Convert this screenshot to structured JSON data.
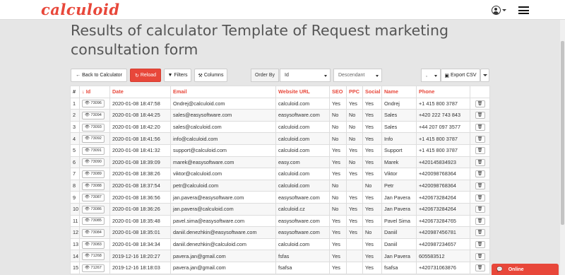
{
  "app": {
    "logo": "calculoid"
  },
  "page": {
    "title": "Results of calculator Template of Request marketing consultation form"
  },
  "toolbar": {
    "back_label": "Back to Calculator",
    "reload_label": "Reload",
    "filters_label": "Filters",
    "columns_label": "Columns",
    "orderby_label": "Order By",
    "orderby_value": "Id",
    "direction_value": "Descendant",
    "separator_value": ",",
    "export_label": "Export CSV"
  },
  "table": {
    "columns": [
      "#",
      "Id",
      "Date",
      "Email",
      "Website URL",
      "SEO",
      "PPC",
      "Social",
      "Name",
      "Phone"
    ],
    "rows": [
      {
        "n": "1",
        "id": "73096",
        "date": "2020-01-08 18:47:58",
        "email": "Ondrej@calculoid.com",
        "url": "calculoid.com",
        "seo": "Yes",
        "ppc": "Yes",
        "social": "Yes",
        "name": "Ondrej",
        "phone": "+1 415 800 3787"
      },
      {
        "n": "2",
        "id": "73094",
        "date": "2020-01-08 18:44:25",
        "email": "sales@easysoftware.com",
        "url": "easysoftware.com",
        "seo": "No",
        "ppc": "No",
        "social": "Yes",
        "name": "Sales",
        "phone": "+420 222 743 843"
      },
      {
        "n": "3",
        "id": "73093",
        "date": "2020-01-08 18:42:20",
        "email": "sales@calculoid.com",
        "url": "calculoid.com",
        "seo": "No",
        "ppc": "No",
        "social": "Yes",
        "name": "Sales",
        "phone": "+44 207 097 3577"
      },
      {
        "n": "4",
        "id": "73092",
        "date": "2020-01-08 18:41:56",
        "email": "info@calculoid.com",
        "url": "calculoid.com",
        "seo": "No",
        "ppc": "No",
        "social": "Yes",
        "name": "Info",
        "phone": "+1 415 800 3787"
      },
      {
        "n": "5",
        "id": "73091",
        "date": "2020-01-08 18:41:32",
        "email": "support@calculoid.com",
        "url": "calculoid.com",
        "seo": "Yes",
        "ppc": "Yes",
        "social": "Yes",
        "name": "Support",
        "phone": "+1 415 800 3787"
      },
      {
        "n": "6",
        "id": "73090",
        "date": "2020-01-08 18:39:09",
        "email": "marek@easysoftware.com",
        "url": "easy.com",
        "seo": "Yes",
        "ppc": "No",
        "social": "Yes",
        "name": "Marek",
        "phone": "+420145834923"
      },
      {
        "n": "7",
        "id": "73089",
        "date": "2020-01-08 18:38:26",
        "email": "viktor@calculoid.com",
        "url": "calculoid.com",
        "seo": "Yes",
        "ppc": "Yes",
        "social": "Yes",
        "name": "Viktor",
        "phone": "+420098768364"
      },
      {
        "n": "8",
        "id": "73088",
        "date": "2020-01-08 18:37:54",
        "email": "petr@calculoid.com",
        "url": "calculoid.com",
        "seo": "No",
        "ppc": "",
        "social": "No",
        "name": "Petr",
        "phone": "+420098768364"
      },
      {
        "n": "9",
        "id": "73087",
        "date": "2020-01-08 18:36:56",
        "email": "jan.pavera@easysoftware.com",
        "url": "easysoftware.com",
        "seo": "No",
        "ppc": "Yes",
        "social": "Yes",
        "name": "Jan Pavera",
        "phone": "+420673284264"
      },
      {
        "n": "10",
        "id": "73086",
        "date": "2020-01-08 18:36:26",
        "email": "jan.pavera@calculoid.com",
        "url": "calculoid.cz",
        "seo": "No",
        "ppc": "Yes",
        "social": "Yes",
        "name": "Jan Pavera",
        "phone": "+420673284264"
      },
      {
        "n": "11",
        "id": "73085",
        "date": "2020-01-08 18:35:48",
        "email": "pavel.sima@easysoftware.com",
        "url": "easysoftware.com",
        "seo": "Yes",
        "ppc": "Yes",
        "social": "Yes",
        "name": "Pavel Sima",
        "phone": "+420673284765"
      },
      {
        "n": "12",
        "id": "73084",
        "date": "2020-01-08 18:35:01",
        "email": "daniil.denezhkin@easysoftware.com",
        "url": "easysoftware.com",
        "seo": "Yes",
        "ppc": "Yes",
        "social": "No",
        "name": "Daniil",
        "phone": "+420987456781"
      },
      {
        "n": "13",
        "id": "73083",
        "date": "2020-01-08 18:34:34",
        "email": "daniil.denezhkin@calculoid.com",
        "url": "calculoid.com",
        "seo": "Yes",
        "ppc": "",
        "social": "Yes",
        "name": "Daniil",
        "phone": "+420987234657"
      },
      {
        "n": "14",
        "id": "71268",
        "date": "2019-12-16 18:20:27",
        "email": "pavera.jan@gmail.com",
        "url": "fsfas",
        "seo": "Yes",
        "ppc": "",
        "social": "Yes",
        "name": "Jan Pavera",
        "phone": "605583512"
      },
      {
        "n": "15",
        "id": "71267",
        "date": "2019-12-16 18:18:03",
        "email": "pavera.jan@gmail.com",
        "url": "fsafsa",
        "seo": "Yes",
        "ppc": "",
        "social": "Yes",
        "name": "fsafsa",
        "phone": "+420731063876"
      }
    ]
  },
  "chat": {
    "label": "Online"
  },
  "colors": {
    "accent": "#e8473a",
    "background": "#e6e6e6"
  }
}
